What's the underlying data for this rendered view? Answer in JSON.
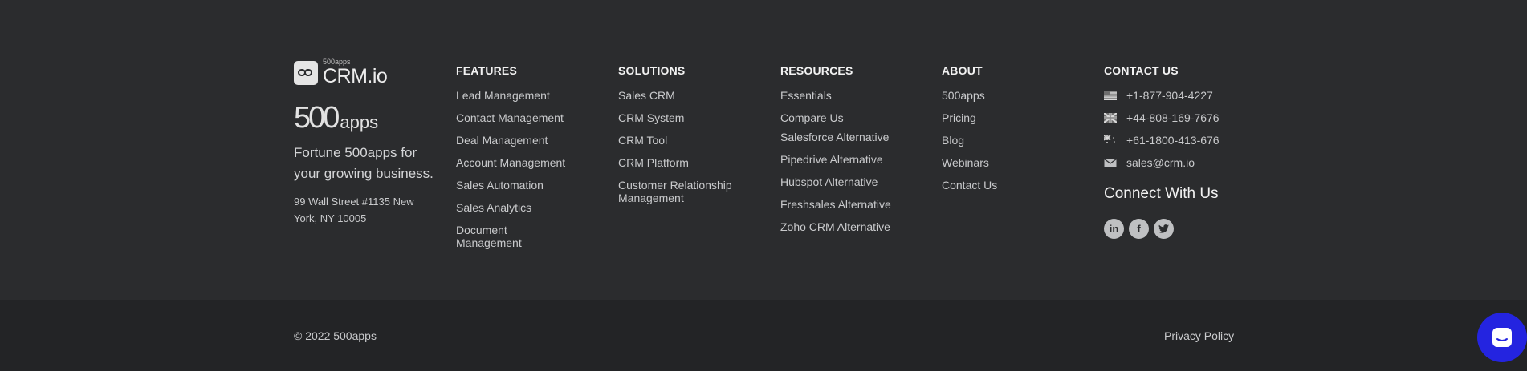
{
  "brand": {
    "logo_small": "500apps",
    "logo_main": "CRM.io",
    "fivehundred_num": "500",
    "fivehundred_apps": "apps",
    "tagline": "Fortune 500apps for your growing business.",
    "address": "99 Wall Street #1135 New York, NY 10005"
  },
  "features": {
    "heading": "FEATURES",
    "items": [
      "Lead Management",
      "Contact Management",
      "Deal Management",
      "Account Management",
      "Sales Automation",
      "Sales Analytics",
      "Document Management"
    ]
  },
  "solutions": {
    "heading": "SOLUTIONS",
    "items": [
      "Sales CRM",
      "CRM System",
      "CRM Tool",
      "CRM Platform",
      "Customer Relationship Management"
    ]
  },
  "resources": {
    "heading": "RESOURCES",
    "items": [
      "Essentials",
      "Compare Us",
      "Salesforce Alternative",
      "Pipedrive Alternative",
      "Hubspot Alternative",
      "Freshsales Alternative",
      "Zoho CRM Alternative"
    ]
  },
  "about": {
    "heading": "ABOUT",
    "items": [
      "500apps",
      "Pricing",
      "Blog",
      "Webinars",
      "Contact Us"
    ]
  },
  "contact": {
    "heading": "CONTACT US",
    "us_phone": "+1-877-904-4227",
    "uk_phone": "+44-808-169-7676",
    "au_phone": "+61-1800-413-676",
    "email": "sales@crm.io",
    "connect": "Connect With Us",
    "icons": [
      "us-flag-icon",
      "uk-flag-icon",
      "au-flag-icon",
      "mail-icon",
      "linkedin-icon",
      "facebook-icon",
      "twitter-icon"
    ]
  },
  "bottom": {
    "copyright": "© 2022 500apps",
    "privacy": "Privacy Policy"
  },
  "colors": {
    "background": "#2b2c2e",
    "bottom_bar": "#232426",
    "chat_button": "#2424e0"
  }
}
